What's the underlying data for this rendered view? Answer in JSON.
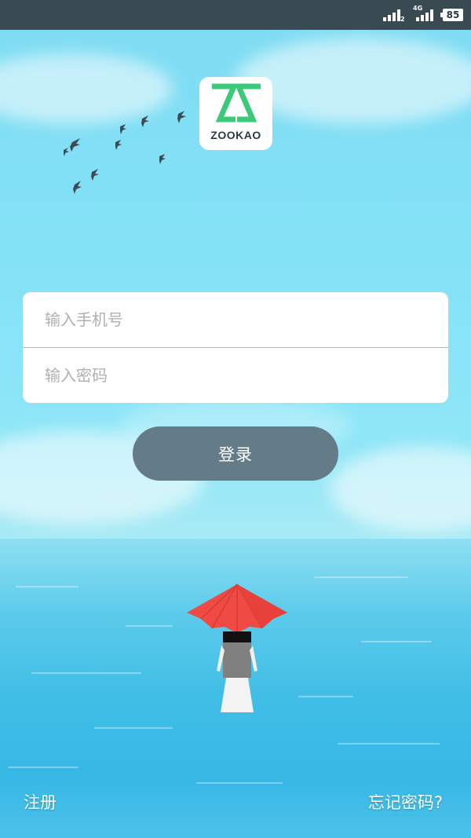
{
  "status_bar": {
    "network_sim1": "2",
    "network_sim2": "4G",
    "battery_level": "85"
  },
  "logo": {
    "brand_text": "ZOOKAO",
    "brand_color": "#3cc97a"
  },
  "form": {
    "phone_placeholder": "输入手机号",
    "password_placeholder": "输入密码",
    "login_label": "登录"
  },
  "footer": {
    "register_label": "注册",
    "forgot_label": "忘记密码?"
  },
  "colors": {
    "login_button": "#637c87",
    "status_bar": "#3a4a52",
    "umbrella": "#ef4a43"
  }
}
